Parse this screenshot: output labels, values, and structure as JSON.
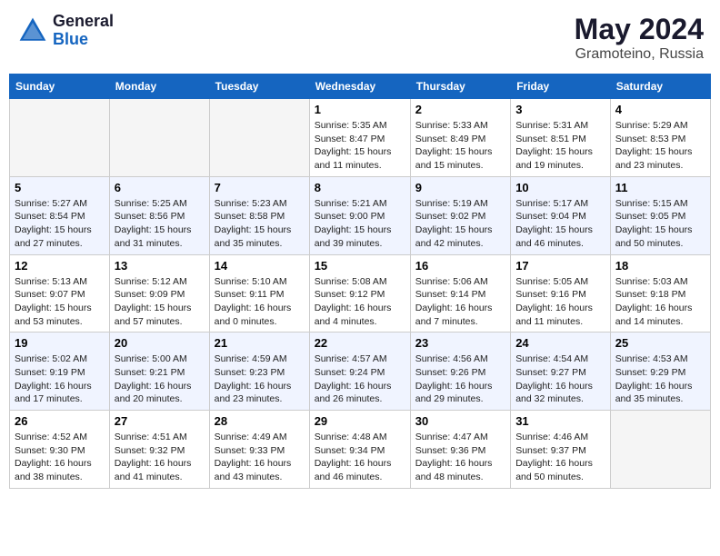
{
  "header": {
    "logo_general": "General",
    "logo_blue": "Blue",
    "month_year": "May 2024",
    "location": "Gramoteino, Russia"
  },
  "days_of_week": [
    "Sunday",
    "Monday",
    "Tuesday",
    "Wednesday",
    "Thursday",
    "Friday",
    "Saturday"
  ],
  "weeks": [
    [
      {
        "day": "",
        "info": ""
      },
      {
        "day": "",
        "info": ""
      },
      {
        "day": "",
        "info": ""
      },
      {
        "day": "1",
        "info": "Sunrise: 5:35 AM\nSunset: 8:47 PM\nDaylight: 15 hours\nand 11 minutes."
      },
      {
        "day": "2",
        "info": "Sunrise: 5:33 AM\nSunset: 8:49 PM\nDaylight: 15 hours\nand 15 minutes."
      },
      {
        "day": "3",
        "info": "Sunrise: 5:31 AM\nSunset: 8:51 PM\nDaylight: 15 hours\nand 19 minutes."
      },
      {
        "day": "4",
        "info": "Sunrise: 5:29 AM\nSunset: 8:53 PM\nDaylight: 15 hours\nand 23 minutes."
      }
    ],
    [
      {
        "day": "5",
        "info": "Sunrise: 5:27 AM\nSunset: 8:54 PM\nDaylight: 15 hours\nand 27 minutes."
      },
      {
        "day": "6",
        "info": "Sunrise: 5:25 AM\nSunset: 8:56 PM\nDaylight: 15 hours\nand 31 minutes."
      },
      {
        "day": "7",
        "info": "Sunrise: 5:23 AM\nSunset: 8:58 PM\nDaylight: 15 hours\nand 35 minutes."
      },
      {
        "day": "8",
        "info": "Sunrise: 5:21 AM\nSunset: 9:00 PM\nDaylight: 15 hours\nand 39 minutes."
      },
      {
        "day": "9",
        "info": "Sunrise: 5:19 AM\nSunset: 9:02 PM\nDaylight: 15 hours\nand 42 minutes."
      },
      {
        "day": "10",
        "info": "Sunrise: 5:17 AM\nSunset: 9:04 PM\nDaylight: 15 hours\nand 46 minutes."
      },
      {
        "day": "11",
        "info": "Sunrise: 5:15 AM\nSunset: 9:05 PM\nDaylight: 15 hours\nand 50 minutes."
      }
    ],
    [
      {
        "day": "12",
        "info": "Sunrise: 5:13 AM\nSunset: 9:07 PM\nDaylight: 15 hours\nand 53 minutes."
      },
      {
        "day": "13",
        "info": "Sunrise: 5:12 AM\nSunset: 9:09 PM\nDaylight: 15 hours\nand 57 minutes."
      },
      {
        "day": "14",
        "info": "Sunrise: 5:10 AM\nSunset: 9:11 PM\nDaylight: 16 hours\nand 0 minutes."
      },
      {
        "day": "15",
        "info": "Sunrise: 5:08 AM\nSunset: 9:12 PM\nDaylight: 16 hours\nand 4 minutes."
      },
      {
        "day": "16",
        "info": "Sunrise: 5:06 AM\nSunset: 9:14 PM\nDaylight: 16 hours\nand 7 minutes."
      },
      {
        "day": "17",
        "info": "Sunrise: 5:05 AM\nSunset: 9:16 PM\nDaylight: 16 hours\nand 11 minutes."
      },
      {
        "day": "18",
        "info": "Sunrise: 5:03 AM\nSunset: 9:18 PM\nDaylight: 16 hours\nand 14 minutes."
      }
    ],
    [
      {
        "day": "19",
        "info": "Sunrise: 5:02 AM\nSunset: 9:19 PM\nDaylight: 16 hours\nand 17 minutes."
      },
      {
        "day": "20",
        "info": "Sunrise: 5:00 AM\nSunset: 9:21 PM\nDaylight: 16 hours\nand 20 minutes."
      },
      {
        "day": "21",
        "info": "Sunrise: 4:59 AM\nSunset: 9:23 PM\nDaylight: 16 hours\nand 23 minutes."
      },
      {
        "day": "22",
        "info": "Sunrise: 4:57 AM\nSunset: 9:24 PM\nDaylight: 16 hours\nand 26 minutes."
      },
      {
        "day": "23",
        "info": "Sunrise: 4:56 AM\nSunset: 9:26 PM\nDaylight: 16 hours\nand 29 minutes."
      },
      {
        "day": "24",
        "info": "Sunrise: 4:54 AM\nSunset: 9:27 PM\nDaylight: 16 hours\nand 32 minutes."
      },
      {
        "day": "25",
        "info": "Sunrise: 4:53 AM\nSunset: 9:29 PM\nDaylight: 16 hours\nand 35 minutes."
      }
    ],
    [
      {
        "day": "26",
        "info": "Sunrise: 4:52 AM\nSunset: 9:30 PM\nDaylight: 16 hours\nand 38 minutes."
      },
      {
        "day": "27",
        "info": "Sunrise: 4:51 AM\nSunset: 9:32 PM\nDaylight: 16 hours\nand 41 minutes."
      },
      {
        "day": "28",
        "info": "Sunrise: 4:49 AM\nSunset: 9:33 PM\nDaylight: 16 hours\nand 43 minutes."
      },
      {
        "day": "29",
        "info": "Sunrise: 4:48 AM\nSunset: 9:34 PM\nDaylight: 16 hours\nand 46 minutes."
      },
      {
        "day": "30",
        "info": "Sunrise: 4:47 AM\nSunset: 9:36 PM\nDaylight: 16 hours\nand 48 minutes."
      },
      {
        "day": "31",
        "info": "Sunrise: 4:46 AM\nSunset: 9:37 PM\nDaylight: 16 hours\nand 50 minutes."
      },
      {
        "day": "",
        "info": ""
      }
    ]
  ]
}
